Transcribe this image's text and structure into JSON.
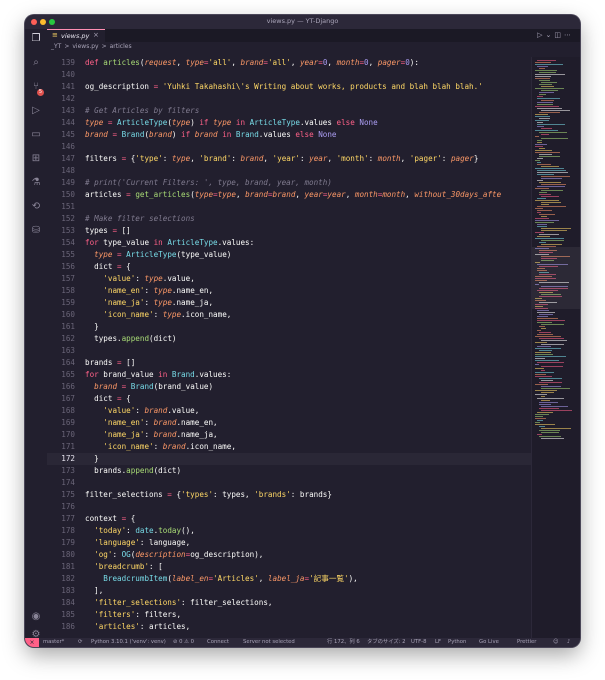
{
  "window": {
    "title": "views.py — YT-Django"
  },
  "tab": {
    "label": "views.py",
    "icon": "python-file-icon"
  },
  "breadcrumb": [
    "_YT",
    ">",
    "views.py",
    ">",
    "articles"
  ],
  "editor": {
    "current_line": "172",
    "lines": [
      {
        "n": "139",
        "i": 0,
        "t": [
          [
            "def ",
            "k"
          ],
          [
            "articles",
            "f"
          ],
          [
            "(",
            "o"
          ],
          [
            "request",
            "p"
          ],
          [
            ", ",
            "o"
          ],
          [
            "type",
            "p"
          ],
          [
            "=",
            "k"
          ],
          [
            "'all'",
            "s"
          ],
          [
            ", ",
            "o"
          ],
          [
            "brand",
            "p"
          ],
          [
            "=",
            "k"
          ],
          [
            "'all'",
            "s"
          ],
          [
            ", ",
            "o"
          ],
          [
            "year",
            "p"
          ],
          [
            "=",
            "k"
          ],
          [
            "0",
            "n"
          ],
          [
            ", ",
            "o"
          ],
          [
            "month",
            "p"
          ],
          [
            "=",
            "k"
          ],
          [
            "0",
            "n"
          ],
          [
            ", ",
            "o"
          ],
          [
            "pager",
            "p"
          ],
          [
            "=",
            "k"
          ],
          [
            "0",
            "n"
          ],
          [
            "):",
            "o"
          ]
        ]
      },
      {
        "n": "140",
        "i": 0,
        "t": []
      },
      {
        "n": "141",
        "i": 1,
        "t": [
          [
            "og_description ",
            "o"
          ],
          [
            "= ",
            "k"
          ],
          [
            "'Yuhki Takahashi\\'s Writing about works, products and blah blah blah.'",
            "s"
          ]
        ]
      },
      {
        "n": "142",
        "i": 0,
        "t": []
      },
      {
        "n": "143",
        "i": 1,
        "t": [
          [
            "# Get Articles by filters",
            "c"
          ]
        ]
      },
      {
        "n": "144",
        "i": 1,
        "t": [
          [
            "type ",
            "p"
          ],
          [
            "= ",
            "k"
          ],
          [
            "ArticleType",
            "t"
          ],
          [
            "(",
            "o"
          ],
          [
            "type",
            "p"
          ],
          [
            ") ",
            "o"
          ],
          [
            "if ",
            "k"
          ],
          [
            "type ",
            "p"
          ],
          [
            "in ",
            "k"
          ],
          [
            "ArticleType",
            "t"
          ],
          [
            ".values ",
            "o"
          ],
          [
            "else ",
            "k"
          ],
          [
            "None",
            "n"
          ]
        ]
      },
      {
        "n": "145",
        "i": 1,
        "t": [
          [
            "brand ",
            "p"
          ],
          [
            "= ",
            "k"
          ],
          [
            "Brand",
            "t"
          ],
          [
            "(",
            "o"
          ],
          [
            "brand",
            "p"
          ],
          [
            ") ",
            "o"
          ],
          [
            "if ",
            "k"
          ],
          [
            "brand ",
            "p"
          ],
          [
            "in ",
            "k"
          ],
          [
            "Brand",
            "t"
          ],
          [
            ".values ",
            "o"
          ],
          [
            "else ",
            "k"
          ],
          [
            "None",
            "n"
          ]
        ]
      },
      {
        "n": "146",
        "i": 0,
        "t": []
      },
      {
        "n": "147",
        "i": 1,
        "t": [
          [
            "filters ",
            "o"
          ],
          [
            "= ",
            "k"
          ],
          [
            "{",
            "o"
          ],
          [
            "'type'",
            "s"
          ],
          [
            ": ",
            "o"
          ],
          [
            "type",
            "p"
          ],
          [
            ", ",
            "o"
          ],
          [
            "'brand'",
            "s"
          ],
          [
            ": ",
            "o"
          ],
          [
            "brand",
            "p"
          ],
          [
            ", ",
            "o"
          ],
          [
            "'year'",
            "s"
          ],
          [
            ": ",
            "o"
          ],
          [
            "year",
            "p"
          ],
          [
            ", ",
            "o"
          ],
          [
            "'month'",
            "s"
          ],
          [
            ": ",
            "o"
          ],
          [
            "month",
            "p"
          ],
          [
            ", ",
            "o"
          ],
          [
            "'pager'",
            "s"
          ],
          [
            ": ",
            "o"
          ],
          [
            "pager",
            "p"
          ],
          [
            "}",
            "o"
          ]
        ]
      },
      {
        "n": "148",
        "i": 0,
        "t": []
      },
      {
        "n": "149",
        "i": 1,
        "t": [
          [
            "# print('Current Filters: ', type, brand, year, month)",
            "c"
          ]
        ]
      },
      {
        "n": "150",
        "i": 1,
        "t": [
          [
            "articles ",
            "o"
          ],
          [
            "= ",
            "k"
          ],
          [
            "get_articles",
            "f"
          ],
          [
            "(",
            "o"
          ],
          [
            "type",
            "p"
          ],
          [
            "=",
            "k"
          ],
          [
            "type",
            "p"
          ],
          [
            ", ",
            "o"
          ],
          [
            "brand",
            "p"
          ],
          [
            "=",
            "k"
          ],
          [
            "brand",
            "p"
          ],
          [
            ", ",
            "o"
          ],
          [
            "year",
            "p"
          ],
          [
            "=",
            "k"
          ],
          [
            "year",
            "p"
          ],
          [
            ", ",
            "o"
          ],
          [
            "month",
            "p"
          ],
          [
            "=",
            "k"
          ],
          [
            "month",
            "p"
          ],
          [
            ", ",
            "o"
          ],
          [
            "without_30days_afte",
            "p"
          ]
        ]
      },
      {
        "n": "151",
        "i": 0,
        "t": []
      },
      {
        "n": "152",
        "i": 1,
        "t": [
          [
            "# Make filter selections",
            "c"
          ]
        ]
      },
      {
        "n": "153",
        "i": 1,
        "t": [
          [
            "types ",
            "o"
          ],
          [
            "= ",
            "k"
          ],
          [
            "[]",
            "o"
          ]
        ]
      },
      {
        "n": "154",
        "i": 1,
        "t": [
          [
            "for ",
            "k"
          ],
          [
            "type_value ",
            "o"
          ],
          [
            "in ",
            "k"
          ],
          [
            "ArticleType",
            "t"
          ],
          [
            ".values:",
            "o"
          ]
        ]
      },
      {
        "n": "155",
        "i": 2,
        "t": [
          [
            "type ",
            "p"
          ],
          [
            "= ",
            "k"
          ],
          [
            "ArticleType",
            "t"
          ],
          [
            "(",
            "o"
          ],
          [
            "type_value",
            "o"
          ],
          [
            ")",
            "o"
          ]
        ]
      },
      {
        "n": "156",
        "i": 2,
        "t": [
          [
            "dict ",
            "o"
          ],
          [
            "= ",
            "k"
          ],
          [
            "{",
            "o"
          ]
        ]
      },
      {
        "n": "157",
        "i": 3,
        "t": [
          [
            "'value'",
            "s"
          ],
          [
            ": ",
            "o"
          ],
          [
            "type",
            "p"
          ],
          [
            ".value,",
            "o"
          ]
        ]
      },
      {
        "n": "158",
        "i": 3,
        "t": [
          [
            "'name_en'",
            "s"
          ],
          [
            ": ",
            "o"
          ],
          [
            "type",
            "p"
          ],
          [
            ".name_en,",
            "o"
          ]
        ]
      },
      {
        "n": "159",
        "i": 3,
        "t": [
          [
            "'name_ja'",
            "s"
          ],
          [
            ": ",
            "o"
          ],
          [
            "type",
            "p"
          ],
          [
            ".name_ja,",
            "o"
          ]
        ]
      },
      {
        "n": "160",
        "i": 3,
        "t": [
          [
            "'icon_name'",
            "s"
          ],
          [
            ": ",
            "o"
          ],
          [
            "type",
            "p"
          ],
          [
            ".icon_name,",
            "o"
          ]
        ]
      },
      {
        "n": "161",
        "i": 2,
        "t": [
          [
            "}",
            "o"
          ]
        ]
      },
      {
        "n": "162",
        "i": 2,
        "t": [
          [
            "types",
            "o"
          ],
          [
            ".",
            "o"
          ],
          [
            "append",
            "f"
          ],
          [
            "(dict)",
            "o"
          ]
        ]
      },
      {
        "n": "163",
        "i": 0,
        "t": []
      },
      {
        "n": "164",
        "i": 1,
        "t": [
          [
            "brands ",
            "o"
          ],
          [
            "= ",
            "k"
          ],
          [
            "[]",
            "o"
          ]
        ]
      },
      {
        "n": "165",
        "i": 1,
        "t": [
          [
            "for ",
            "k"
          ],
          [
            "brand_value ",
            "o"
          ],
          [
            "in ",
            "k"
          ],
          [
            "Brand",
            "t"
          ],
          [
            ".values:",
            "o"
          ]
        ]
      },
      {
        "n": "166",
        "i": 2,
        "t": [
          [
            "brand ",
            "p"
          ],
          [
            "= ",
            "k"
          ],
          [
            "Brand",
            "t"
          ],
          [
            "(",
            "o"
          ],
          [
            "brand_value",
            "o"
          ],
          [
            ")",
            "o"
          ]
        ]
      },
      {
        "n": "167",
        "i": 2,
        "t": [
          [
            "dict ",
            "o"
          ],
          [
            "= ",
            "k"
          ],
          [
            "{",
            "o"
          ]
        ]
      },
      {
        "n": "168",
        "i": 3,
        "t": [
          [
            "'value'",
            "s"
          ],
          [
            ": ",
            "o"
          ],
          [
            "brand",
            "p"
          ],
          [
            ".value,",
            "o"
          ]
        ]
      },
      {
        "n": "169",
        "i": 3,
        "t": [
          [
            "'name_en'",
            "s"
          ],
          [
            ": ",
            "o"
          ],
          [
            "brand",
            "p"
          ],
          [
            ".name_en,",
            "o"
          ]
        ]
      },
      {
        "n": "170",
        "i": 3,
        "t": [
          [
            "'name_ja'",
            "s"
          ],
          [
            ": ",
            "o"
          ],
          [
            "brand",
            "p"
          ],
          [
            ".name_ja,",
            "o"
          ]
        ]
      },
      {
        "n": "171",
        "i": 3,
        "t": [
          [
            "'icon_name'",
            "s"
          ],
          [
            ": ",
            "o"
          ],
          [
            "brand",
            "p"
          ],
          [
            ".icon_name,",
            "o"
          ]
        ]
      },
      {
        "n": "172",
        "i": 2,
        "t": [
          [
            "}",
            "o"
          ]
        ]
      },
      {
        "n": "173",
        "i": 2,
        "t": [
          [
            "brands",
            "o"
          ],
          [
            ".",
            "o"
          ],
          [
            "append",
            "f"
          ],
          [
            "(dict)",
            "o"
          ]
        ]
      },
      {
        "n": "174",
        "i": 0,
        "t": []
      },
      {
        "n": "175",
        "i": 1,
        "t": [
          [
            "filter_selections ",
            "o"
          ],
          [
            "= ",
            "k"
          ],
          [
            "{",
            "o"
          ],
          [
            "'types'",
            "s"
          ],
          [
            ": types, ",
            "o"
          ],
          [
            "'brands'",
            "s"
          ],
          [
            ": brands}",
            "o"
          ]
        ]
      },
      {
        "n": "176",
        "i": 0,
        "t": []
      },
      {
        "n": "177",
        "i": 1,
        "t": [
          [
            "context ",
            "o"
          ],
          [
            "= ",
            "k"
          ],
          [
            "{",
            "o"
          ]
        ]
      },
      {
        "n": "178",
        "i": 2,
        "t": [
          [
            "'today'",
            "s"
          ],
          [
            ": ",
            "o"
          ],
          [
            "date",
            "t"
          ],
          [
            ".",
            "o"
          ],
          [
            "today",
            "f"
          ],
          [
            "(),",
            "o"
          ]
        ]
      },
      {
        "n": "179",
        "i": 2,
        "t": [
          [
            "'language'",
            "s"
          ],
          [
            ": language,",
            "o"
          ]
        ]
      },
      {
        "n": "180",
        "i": 2,
        "t": [
          [
            "'og'",
            "s"
          ],
          [
            ": ",
            "o"
          ],
          [
            "OG",
            "t"
          ],
          [
            "(",
            "o"
          ],
          [
            "description",
            "p"
          ],
          [
            "=",
            "k"
          ],
          [
            "og_description),",
            "o"
          ]
        ]
      },
      {
        "n": "181",
        "i": 2,
        "t": [
          [
            "'breadcrumb'",
            "s"
          ],
          [
            ": [",
            "o"
          ]
        ]
      },
      {
        "n": "182",
        "i": 3,
        "t": [
          [
            "BreadcrumbItem",
            "t"
          ],
          [
            "(",
            "o"
          ],
          [
            "label_en",
            "p"
          ],
          [
            "=",
            "k"
          ],
          [
            "'Articles'",
            "s"
          ],
          [
            ", ",
            "o"
          ],
          [
            "label_ja",
            "p"
          ],
          [
            "=",
            "k"
          ],
          [
            "'記事一覧'",
            "s"
          ],
          [
            "),",
            "o"
          ]
        ]
      },
      {
        "n": "183",
        "i": 2,
        "t": [
          [
            "],",
            "o"
          ]
        ]
      },
      {
        "n": "184",
        "i": 2,
        "t": [
          [
            "'filter_selections'",
            "s"
          ],
          [
            ": filter_selections,",
            "o"
          ]
        ]
      },
      {
        "n": "185",
        "i": 2,
        "t": [
          [
            "'filters'",
            "s"
          ],
          [
            ": filters,",
            "o"
          ]
        ]
      },
      {
        "n": "186",
        "i": 2,
        "t": [
          [
            "'articles'",
            "s"
          ],
          [
            ": articles,",
            "o"
          ]
        ]
      }
    ]
  },
  "status": {
    "branch": "master*",
    "python": "Python 3.10.1 ('venv': venv)",
    "problems": "⊘ 0 ⚠ 0",
    "connect": "Connect",
    "server": "Server not selected",
    "position": "行 172、列 6",
    "tabsize": "タブのサイズ: 2",
    "encoding": "UTF-8",
    "eol": "LF",
    "language": "Python",
    "golive": "Go Live",
    "prettier": "Prettier"
  },
  "colors": {
    "accent": "#ff6188",
    "keyword": "#ff6188",
    "function": "#a9dc76",
    "string": "#ffd866",
    "param": "#fc9867",
    "number": "#ab9df2",
    "type": "#78dce8",
    "comment": "#7f7a8e",
    "background": "#221f2e"
  }
}
